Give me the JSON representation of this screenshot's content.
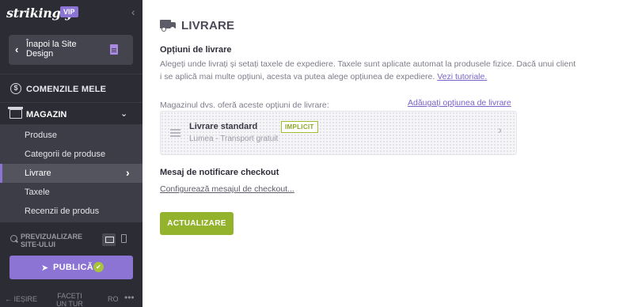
{
  "sidebar": {
    "logo": "strikingly",
    "vip_badge": "VIP",
    "collapse_icon": "‹",
    "back_label": "Înapoi la Site Design",
    "orders_label": "COMENZILE MELE",
    "orders_icon": "$",
    "store_label": "MAGAZIN",
    "store_items": [
      {
        "label": "Produse"
      },
      {
        "label": "Categorii de produse"
      },
      {
        "label": "Livrare",
        "active": true
      },
      {
        "label": "Taxele"
      },
      {
        "label": "Recenzii de produs"
      }
    ],
    "preview_label": "PREVIZUALIZARE SITE-ULUI",
    "publish_label": "PUBLICĂ",
    "footer": {
      "exit": "← IEȘIRE",
      "tour": "FACEȚI UN TUR",
      "lang": "RO",
      "more": "•••"
    }
  },
  "main": {
    "title": "LIVRARE",
    "options_heading": "Opțiuni de livrare",
    "description": "Alegeți unde livrați și setați taxele de expediere. Taxele sunt aplicate automat la produsele fizice. Dacă unui client i se aplică mai multe opțiuni, acesta va putea alege opțiunea de expediere.",
    "tutorial_link": "Vezi tutoriale.",
    "options_label": "Magazinul dvs. oferă aceste opțiuni de livrare:",
    "add_option_link": "Adăugați opțiunea de livrare",
    "shipping_option": {
      "name": "Livrare standard",
      "badge": "IMPLICIT",
      "subtitle": "Lumea - Transport gratuit"
    },
    "checkout_heading": "Mesaj de notificare checkout",
    "checkout_link": "Configurează mesajul de checkout...",
    "update_button": "ACTUALIZARE"
  },
  "colors": {
    "sidebar_bg": "#2c2c35",
    "accent_purple": "#8b74d4",
    "accent_green": "#94b32c"
  }
}
